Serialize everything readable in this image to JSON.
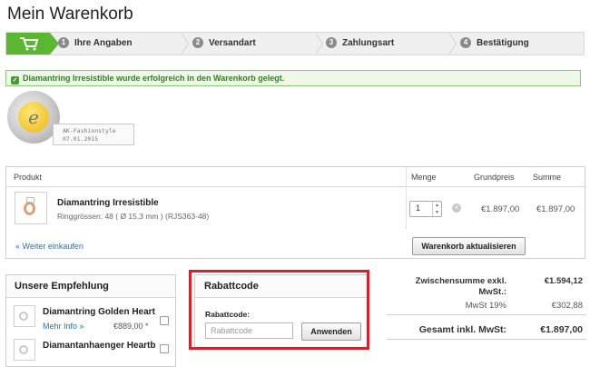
{
  "page_title": "Mein Warenkorb",
  "steps": [
    {
      "num": "1",
      "label": "Ihre Angaben"
    },
    {
      "num": "2",
      "label": "Versandart"
    },
    {
      "num": "3",
      "label": "Zahlungsart"
    },
    {
      "num": "4",
      "label": "Bestätigung"
    }
  ],
  "success_message": "Diamantring Irresistible wurde erfolgreich in den Warenkorb gelegt.",
  "seal": {
    "text_line1": "AK-Fashionstyle",
    "text_line2": "07.01.2015"
  },
  "cart": {
    "headers": {
      "product": "Produkt",
      "quantity": "Menge",
      "unit_price": "Grundpreis",
      "total": "Summe"
    },
    "item": {
      "name": "Diamantring Irresistible",
      "detail": "Ringgrössen: 48 ( Ø 15,3 mm ) (RJS363-48)",
      "quantity": "1",
      "unit_price": "€1.897,00",
      "total": "€1.897,00"
    },
    "continue_link": "« Weiter einkaufen",
    "update_button": "Warenkorb aktualisieren"
  },
  "recommendation": {
    "title": "Unsere Empfehlung",
    "items": [
      {
        "name": "Diamantring Golden Heart",
        "more": "Mehr Info »",
        "price": "€889,00 *"
      },
      {
        "name": "Diamantanhaenger Heartb"
      }
    ]
  },
  "coupon": {
    "title": "Rabattcode",
    "label": "Rabattcode:",
    "placeholder": "Rabattcode",
    "apply_button": "Anwenden"
  },
  "totals": {
    "subtotal_label": "Zwischensumme exkl. MwSt.:",
    "subtotal_value": "€1.594,12",
    "vat_label": "MwSt 19%",
    "vat_value": "€302,88",
    "grand_label": "Gesamt inkl. MwSt:",
    "grand_value": "€1.897,00"
  },
  "colors": {
    "accent_green": "#5bb731",
    "highlight_red": "#d7202a",
    "link_blue": "#2c6fb5"
  }
}
